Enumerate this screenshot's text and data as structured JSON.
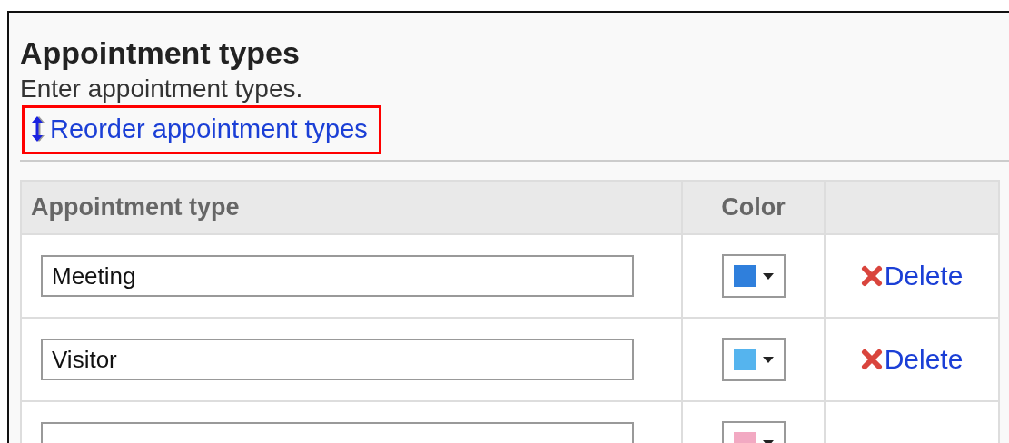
{
  "section": {
    "title": "Appointment types",
    "description": "Enter appointment types.",
    "reorder_link": "Reorder appointment types"
  },
  "table": {
    "columns": [
      "Appointment type",
      "Color"
    ],
    "rows": [
      {
        "value": "Meeting",
        "color": "#2f7fdc",
        "action": "Delete"
      },
      {
        "value": "Visitor",
        "color": "#55b4ee",
        "action": "Delete"
      },
      {
        "color": "#f2a9c2"
      }
    ]
  }
}
